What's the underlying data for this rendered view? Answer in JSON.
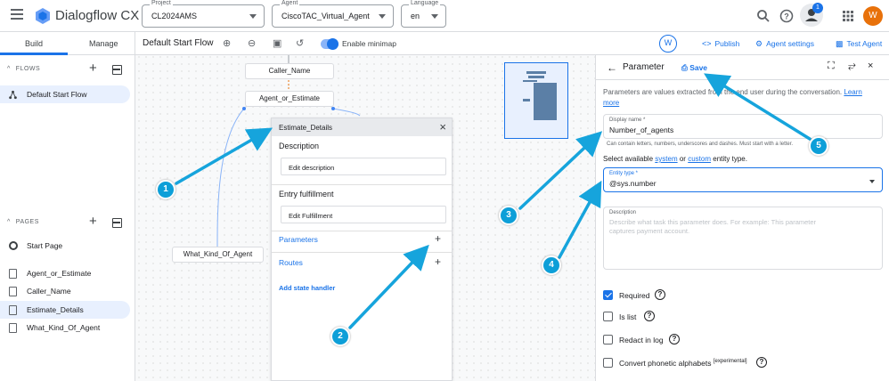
{
  "app": {
    "title": "Dialogflow CX"
  },
  "header": {
    "project": {
      "label": "Project",
      "value": "CL2024AMS"
    },
    "agent": {
      "label": "Agent",
      "value": "CiscoTAC_Virtual_Agent"
    },
    "language": {
      "label": "Language",
      "value": "en"
    },
    "notification_count": "1",
    "user_initial": "W"
  },
  "left_nav": {
    "tabs": [
      "Build",
      "Manage"
    ],
    "flows_heading": "FLOWS",
    "flows": [
      "Default Start Flow"
    ],
    "pages_heading": "PAGES",
    "pages": [
      "Start Page",
      "Agent_or_Estimate",
      "Caller_Name",
      "Estimate_Details",
      "What_Kind_Of_Agent"
    ]
  },
  "canvas": {
    "flow_title": "Default Start Flow",
    "minimap_label": "Enable minimap",
    "nodes": [
      "Caller_Name",
      "Agent_or_Estimate",
      "What_Kind_Of_Agent"
    ],
    "detail_card": {
      "title": "Estimate_Details",
      "description_label": "Description",
      "edit_description": "Edit description",
      "entry_fulfillment_label": "Entry fulfillment",
      "edit_fulfillment": "Edit Fulfillment",
      "parameters_label": "Parameters",
      "routes_label": "Routes",
      "add_state_handler": "Add state handler"
    }
  },
  "top_actions": {
    "avatar_initial": "W",
    "publish": "Publish",
    "agent_settings": "Agent settings",
    "test_agent": "Test Agent"
  },
  "parameter_panel": {
    "title": "Parameter",
    "save": "Save",
    "intro_text": "Parameters are values extracted from the end user during the conversation.",
    "learn_more": "Learn more",
    "display_name": {
      "label": "Display name *",
      "value": "Number_of_agents",
      "hint": "Can contain letters, numbers, underscores and dashes. Must start with a letter."
    },
    "entity_prompt_prefix": "Select available",
    "entity_link_system": "system",
    "entity_or": "or",
    "entity_link_custom": "custom",
    "entity_prompt_suffix": "entity type.",
    "entity_type": {
      "label": "Entity type *",
      "value": "@sys.number"
    },
    "description": {
      "label": "Description",
      "placeholder": "Describe what task this parameter does. For example: This parameter captures payment account."
    },
    "checkboxes": [
      {
        "label": "Required",
        "checked": true
      },
      {
        "label": "Is list",
        "checked": false
      },
      {
        "label": "Redact in log",
        "checked": false
      },
      {
        "label": "Convert phonetic alphabets",
        "checked": false,
        "sup": "[experimental]"
      }
    ]
  },
  "callouts": [
    "1",
    "2",
    "3",
    "4",
    "5"
  ],
  "colors": {
    "accent": "#1a73e8",
    "callout": "#0d9fd8",
    "user_avatar": "#e8710a"
  }
}
